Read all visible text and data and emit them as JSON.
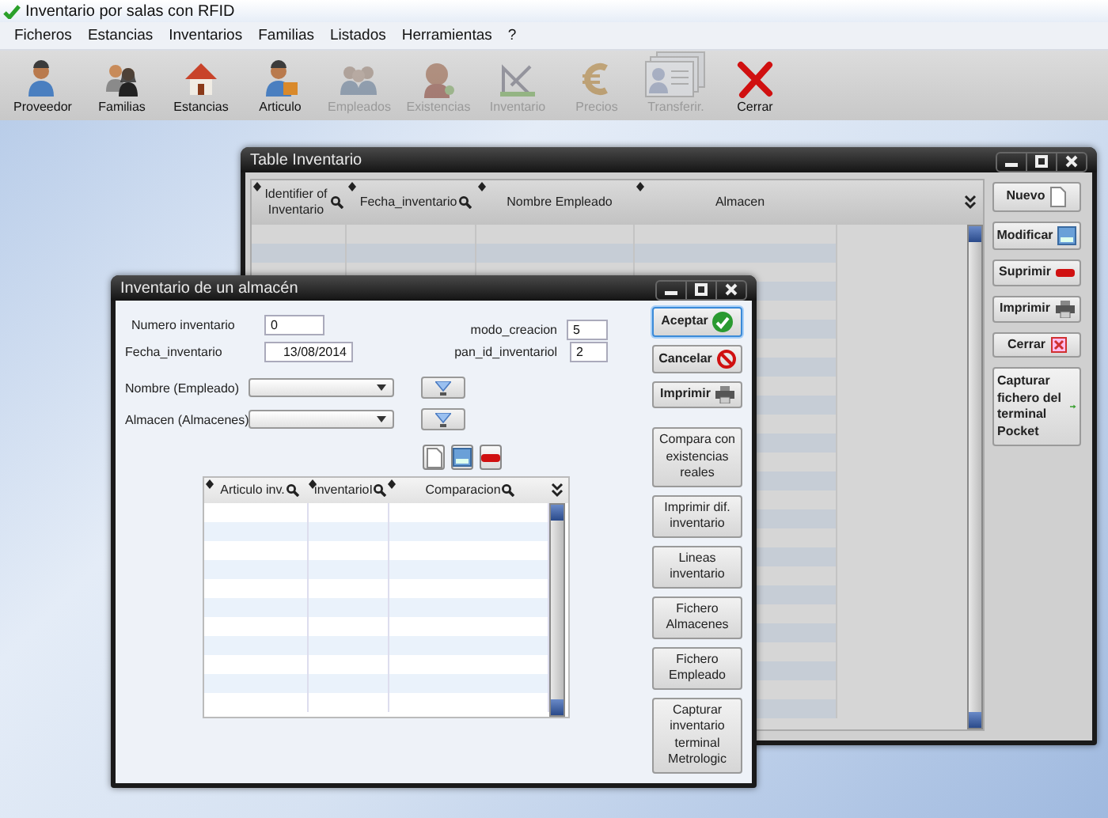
{
  "app": {
    "title": "Inventario por salas con RFID"
  },
  "menu": [
    {
      "label": "Ficheros"
    },
    {
      "label": "Estancias"
    },
    {
      "label": "Inventarios"
    },
    {
      "label": "Familias"
    },
    {
      "label": "Listados"
    },
    {
      "label": "Herramientas"
    },
    {
      "label": "?"
    }
  ],
  "toolbar": [
    {
      "label": "Proveedor",
      "disabled": false
    },
    {
      "label": "Familias",
      "disabled": false
    },
    {
      "label": "Estancias",
      "disabled": false
    },
    {
      "label": "Articulo",
      "disabled": false
    },
    {
      "label": "Empleados",
      "disabled": true
    },
    {
      "label": "Existencias",
      "disabled": true
    },
    {
      "label": "Inventario",
      "disabled": true
    },
    {
      "label": "Precios",
      "disabled": true
    },
    {
      "label": "Transferir.",
      "disabled": true
    },
    {
      "label": "Cerrar",
      "disabled": false
    }
  ],
  "table_window": {
    "title": "Table Inventario",
    "columns": [
      {
        "label": "Identifier of Inventario",
        "searchable": true
      },
      {
        "label": "Fecha_inventario",
        "searchable": true
      },
      {
        "label": "Nombre Empleado",
        "searchable": false
      },
      {
        "label": "Almacen",
        "searchable": false
      }
    ],
    "buttons": [
      {
        "label": "Nuevo"
      },
      {
        "label": "Modificar"
      },
      {
        "label": "Suprimir"
      },
      {
        "label": "Imprimir"
      },
      {
        "label": "Cerrar"
      },
      {
        "label": "Capturar fichero del terminal Pocket"
      }
    ]
  },
  "form_window": {
    "title": "Inventario de un almacén",
    "fields": [
      {
        "label": "Numero inventario",
        "value": "0"
      },
      {
        "label": "modo_creacion",
        "value": "5"
      },
      {
        "label": "Fecha_inventario",
        "value": "13/08/2014"
      },
      {
        "label": "pan_id_inventariol",
        "value": "2"
      }
    ],
    "dropdowns": [
      {
        "label": "Nombre (Empleado)"
      },
      {
        "label": "Almacen (Almacenes)"
      }
    ],
    "grid_columns": [
      {
        "label": "Articulo inv.",
        "searchable": true
      },
      {
        "label": "inventarioI",
        "searchable": true
      },
      {
        "label": "Comparacion",
        "searchable": true
      }
    ],
    "buttons": [
      {
        "label": "Aceptar",
        "focused": true
      },
      {
        "label": "Cancelar",
        "focused": false
      },
      {
        "label": "Imprimir",
        "focused": false
      },
      {
        "label": "Compara con existencias reales",
        "focused": false
      },
      {
        "label": "Imprimir dif. inventario",
        "focused": false
      },
      {
        "label": "Lineas inventario",
        "focused": false
      },
      {
        "label": "Fichero Almacenes",
        "focused": false
      },
      {
        "label": "Fichero Empleado",
        "focused": false
      },
      {
        "label": "Capturar inventario terminal Metrologic",
        "focused": false
      }
    ]
  }
}
